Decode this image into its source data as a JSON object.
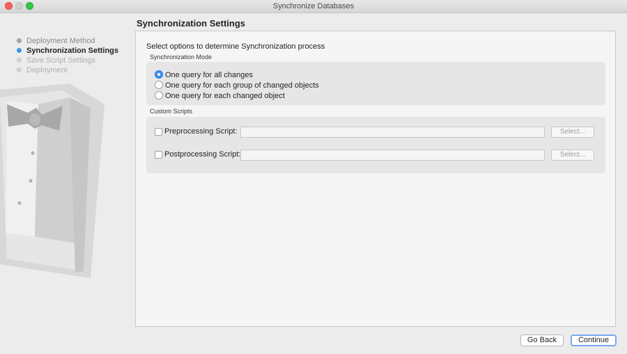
{
  "window": {
    "title": "Synchronize Databases"
  },
  "steps": [
    {
      "label": "Deployment Method",
      "state": "done"
    },
    {
      "label": "Synchronization Settings",
      "state": "active"
    },
    {
      "label": "Save Script Settings",
      "state": "pending"
    },
    {
      "label": "Deployment",
      "state": "pending"
    }
  ],
  "header": {
    "title": "Synchronization Settings"
  },
  "main": {
    "intro": "Select options to determine Synchronization process",
    "sync_mode": {
      "label": "Synchronization Mode",
      "options": [
        {
          "label": "One query for all changes",
          "checked": true
        },
        {
          "label": "One query for each group of changed objects",
          "checked": false
        },
        {
          "label": "One query for each changed object",
          "checked": false
        }
      ]
    },
    "custom_scripts": {
      "label": "Custom Scripts",
      "pre": {
        "label": "Preprocessing Script:",
        "value": "",
        "button": "Select...",
        "checked": false
      },
      "post": {
        "label": "Postprocessing Script:",
        "value": "",
        "button": "Select...",
        "checked": false
      }
    }
  },
  "footer": {
    "back": "Go Back",
    "continue": "Continue"
  },
  "colors": {
    "accent": "#3d95ed",
    "close": "#fc605c",
    "maximize": "#34c84a"
  },
  "icons": {
    "decor": "tuxedo-illustration"
  }
}
